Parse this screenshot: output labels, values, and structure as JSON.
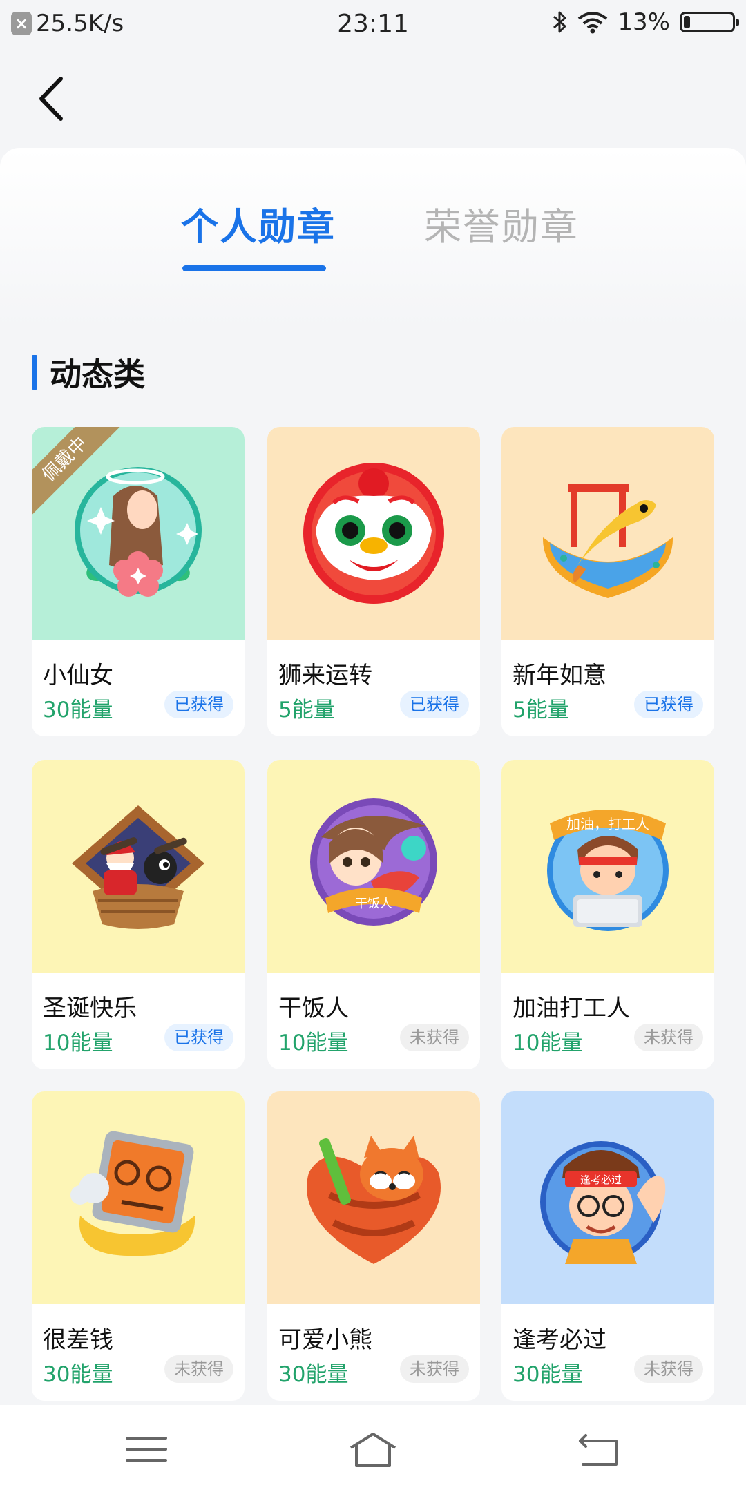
{
  "status_bar": {
    "net_speed": "25.5K/s",
    "time": "23:11",
    "battery": "13%",
    "battery_level": 0.13
  },
  "tabs": [
    {
      "label": "个人勋章",
      "active": true
    },
    {
      "label": "荣誉勋章",
      "active": false
    }
  ],
  "section": {
    "title": "动态类"
  },
  "badges": [
    {
      "name": "小仙女",
      "energy": "30能量",
      "status": "已获得",
      "obtained": true,
      "tag": "佩戴中",
      "bg": "#b6efd8",
      "icon": "fairy-badge-icon"
    },
    {
      "name": "狮来运转",
      "energy": "5能量",
      "status": "已获得",
      "obtained": true,
      "bg": "#fde5bd",
      "icon": "lion-dance-badge-icon"
    },
    {
      "name": "新年如意",
      "energy": "5能量",
      "status": "已获得",
      "obtained": true,
      "bg": "#fde5bd",
      "icon": "koi-boat-badge-icon"
    },
    {
      "name": "圣诞快乐",
      "energy": "10能量",
      "status": "已获得",
      "obtained": true,
      "bg": "#fdf5b6",
      "icon": "christmas-badge-icon"
    },
    {
      "name": "干饭人",
      "energy": "10能量",
      "status": "未获得",
      "obtained": false,
      "bg": "#fdf5b6",
      "icon": "rice-eater-badge-icon",
      "ribbon_text": "干饭人"
    },
    {
      "name": "加油打工人",
      "energy": "10能量",
      "status": "未获得",
      "obtained": false,
      "bg": "#fdf5b6",
      "icon": "worker-badge-icon",
      "ribbon_text": "加油，打工人"
    },
    {
      "name": "很差钱",
      "energy": "30能量",
      "status": "未获得",
      "obtained": false,
      "bg": "#fdf5b6",
      "icon": "broke-wallet-badge-icon"
    },
    {
      "name": "可爱小熊",
      "energy": "30能量",
      "status": "未获得",
      "obtained": false,
      "bg": "#fde5bd",
      "icon": "red-panda-badge-icon"
    },
    {
      "name": "逢考必过",
      "energy": "30能量",
      "status": "未获得",
      "obtained": false,
      "bg": "#c3ddfb",
      "icon": "exam-pass-badge-icon",
      "headband_text": "逢考必过"
    }
  ],
  "colors": {
    "accent": "#1a73e8",
    "energy_text": "#22a36b",
    "wearing_ribbon": "#b2925c"
  }
}
